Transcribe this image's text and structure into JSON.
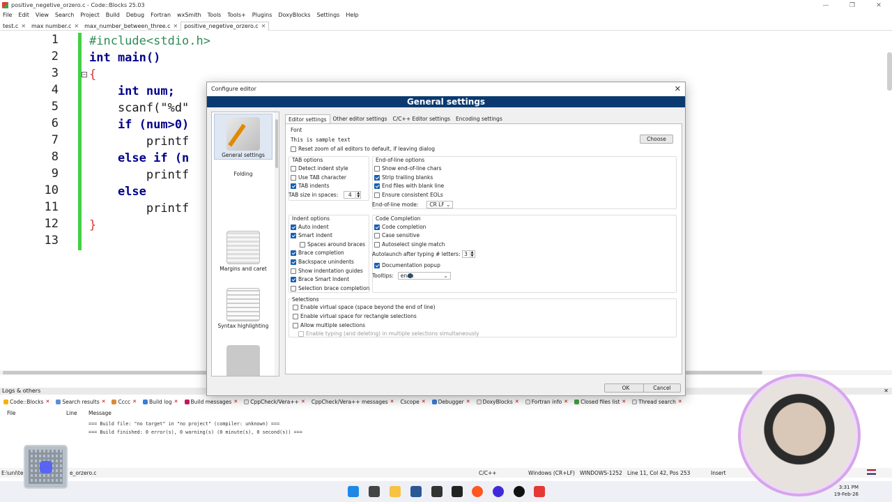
{
  "window": {
    "title": "positive_negetive_orzero.c - Code::Blocks 25.03",
    "controls": [
      "—",
      "❐",
      "✕"
    ]
  },
  "menu": [
    "File",
    "Edit",
    "View",
    "Search",
    "Project",
    "Build",
    "Debug",
    "Fortran",
    "wxSmith",
    "Tools",
    "Tools+",
    "Plugins",
    "DoxyBlocks",
    "Settings",
    "Help"
  ],
  "file_tabs": [
    {
      "label": "test.c",
      "active": false
    },
    {
      "label": "max number.c",
      "active": false
    },
    {
      "label": "max_number_between_three.c",
      "active": false
    },
    {
      "label": "positive_negetive_orzero.c",
      "active": true
    }
  ],
  "editor": {
    "line_numbers": [
      "1",
      "2",
      "3",
      "4",
      "5",
      "6",
      "7",
      "8",
      "9",
      "10",
      "11",
      "12",
      "13"
    ],
    "lines": [
      "#include<stdio.h>",
      "int main()",
      "{",
      "    int num;",
      "    scanf(\"%d\"",
      "    if (num>0)",
      "        printf",
      "    else if (n",
      "        printf",
      "    else",
      "        printf",
      "}",
      ""
    ]
  },
  "dialog": {
    "title": "Configure editor",
    "close": "✕",
    "header": "General settings",
    "sidebar": [
      "General settings",
      "Folding",
      "Margins and caret",
      "Syntax highlighting",
      ""
    ],
    "tabs": [
      "Editor settings",
      "Other editor settings",
      "C/C++ Editor settings",
      "Encoding settings"
    ],
    "font": {
      "legend": "Font",
      "sample": "This is sample text",
      "choose": "Choose",
      "reset_zoom": "Reset zoom of all editors to default, if leaving dialog"
    },
    "tab_options": {
      "legend": "TAB options",
      "detect": "Detect indent style",
      "use_tab": "Use TAB character",
      "tab_indents": "TAB indents",
      "tab_size_label": "TAB size in spaces:",
      "tab_size": "4"
    },
    "eol_options": {
      "legend": "End-of-line options",
      "show_eol": "Show end-of-line chars",
      "strip": "Strip trailing blanks",
      "end_blank": "End files with blank line",
      "ensure": "Ensure consistent EOLs",
      "mode_label": "End-of-line mode:",
      "mode": "CR LF"
    },
    "indent_options": {
      "legend": "Indent options",
      "auto_indent": "Auto indent",
      "smart_indent": "Smart indent",
      "spaces_braces": "Spaces around braces",
      "brace_completion": "Brace completion",
      "backspace": "Backspace unindents",
      "show_guides": "Show indentation guides",
      "brace_smart": "Brace Smart Indent",
      "selection_brace": "Selection brace completion"
    },
    "code_completion": {
      "legend": "Code Completion",
      "code_completion": "Code completion",
      "case_sensitive": "Case sensitive",
      "autoselect": "Autoselect single match",
      "autolaunch_label": "Autolaunch after typing # letters:",
      "autolaunch": "3",
      "doc_popup": "Documentation popup",
      "tooltips_label": "Tooltips:",
      "tooltips": "enab"
    },
    "selections": {
      "legend": "Selections",
      "virtual_space": "Enable virtual space (space beyond the end of line)",
      "virtual_rect": "Enable virtual space for rectangle selections",
      "multiple": "Allow multiple selections",
      "typing_multi": "Enable typing (and deleting) in multiple selections simultaneously"
    },
    "ok": "OK",
    "cancel": "Cancel"
  },
  "logs": {
    "title": "Logs & others",
    "close": "✕",
    "tabs": [
      "Code::Blocks",
      "Search results",
      "Cccc",
      "Build log",
      "Build messages",
      "CppCheck/Vera++",
      "CppCheck/Vera++ messages",
      "Cscope",
      "Debugger",
      "DoxyBlocks",
      "Fortran info",
      "Closed files list",
      "Thread search"
    ],
    "columns": [
      "File",
      "Line",
      "Message"
    ],
    "messages": [
      "=== Build file: \"no target\" in \"no project\" (compiler: unknown) ===",
      "=== Build finished: 0 error(s), 0 warning(s) (0 minute(s), 0 second(s)) ==="
    ]
  },
  "status": {
    "path": "E:\\uni\\tes",
    "file": "e_orzero.c",
    "lang": "C/C++",
    "eol": "Windows (CR+LF)",
    "encoding": "WINDOWS-1252",
    "pos": "Line 11, Col 42, Pos 253",
    "mode": "Insert"
  },
  "clock": {
    "time": "3:31 PM",
    "date": "19-Feb-26"
  },
  "colors": {
    "accent": "#0b3a70",
    "changebar": "#43d143"
  }
}
